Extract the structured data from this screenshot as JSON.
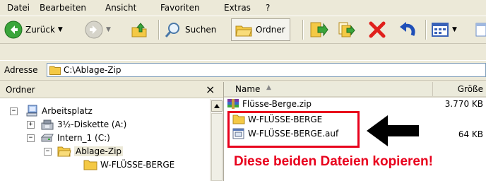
{
  "menu": [
    "Datei",
    "Bearbeiten",
    "Ansicht",
    "Favoriten",
    "Extras",
    "?"
  ],
  "toolbar": {
    "back_label": "Zurück",
    "search_label": "Suchen",
    "folders_label": "Ordner"
  },
  "address": {
    "label": "Adresse",
    "value": "C:\\Ablage-Zip"
  },
  "left_panel": {
    "title": "Ordner",
    "close": "×",
    "tree": [
      {
        "label": "Arbeitsplatz",
        "icon": "computer-icon",
        "expander": "−"
      },
      {
        "label": "3½-Diskette (A:)",
        "icon": "floppy-icon",
        "expander": "+"
      },
      {
        "label": "Intern_1 (C:)",
        "icon": "drive-icon",
        "expander": "−"
      },
      {
        "label": "Ablage-Zip",
        "icon": "open-folder-icon",
        "expander": "−"
      },
      {
        "label": "W-FLÜSSE-BERGE",
        "icon": "folder-icon",
        "expander": ""
      }
    ]
  },
  "right_panel": {
    "col_name": "Name",
    "col_size": "Größe",
    "files": [
      {
        "name": "Flüsse-Berge.zip",
        "size": "3.770 KB",
        "icon": "zip-archive-icon"
      },
      {
        "name": "W-FLÜSSE-BERGE",
        "size": "",
        "icon": "folder-icon"
      },
      {
        "name": "W-FLÜSSE-BERGE.auf",
        "size": "64 KB",
        "icon": "auf-file-icon"
      }
    ]
  },
  "annotation": {
    "text": "Diese beiden Dateien kopieren!",
    "color": "#e8001c"
  }
}
